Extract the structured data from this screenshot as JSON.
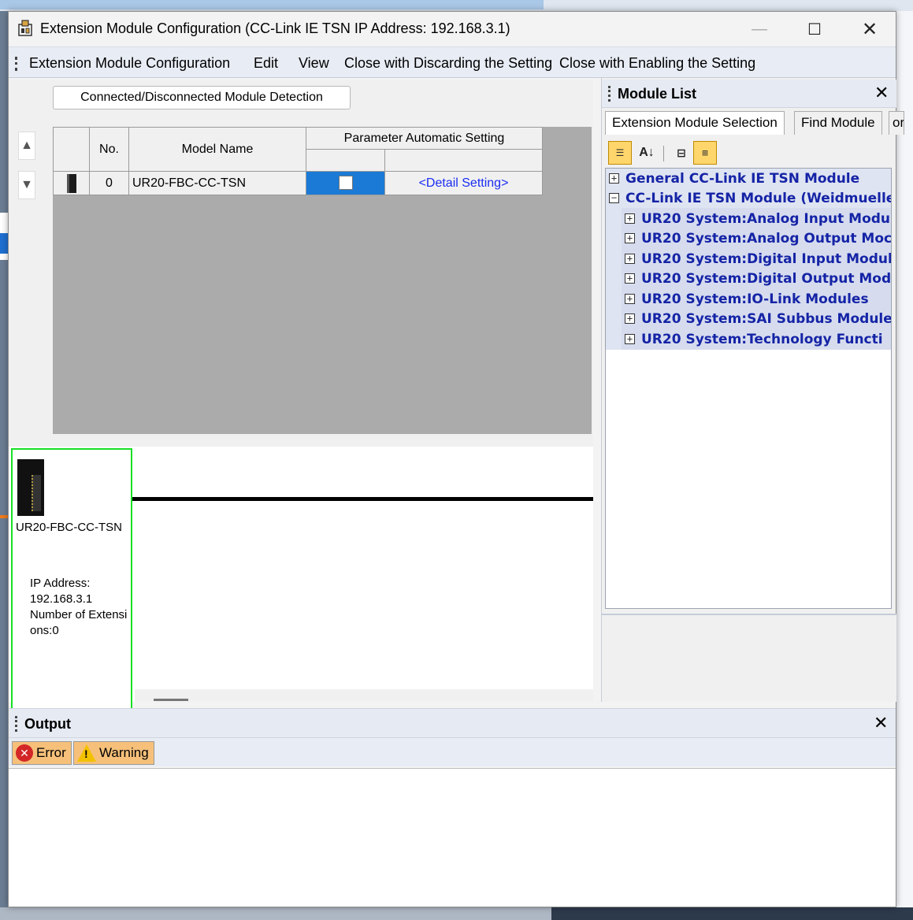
{
  "window": {
    "title": "Extension Module Configuration (CC-Link IE TSN IP Address: 192.168.3.1)",
    "min_glyph": "—",
    "max_glyph": "☐",
    "close_glyph": "✕"
  },
  "menu": {
    "items": [
      "Extension Module Configuration",
      "Edit",
      "View",
      "Close with Discarding the Setting",
      "Close with Enabling the Setting"
    ]
  },
  "main": {
    "detect_button": "Connected/Disconnected Module Detection",
    "up_arrow": "▲",
    "down_arrow": "▼",
    "grid": {
      "col_no": "No.",
      "col_model": "Model Name",
      "col_param": "Parameter Automatic Setting",
      "rows": [
        {
          "no": "0",
          "model": "UR20-FBC-CC-TSN",
          "detail": "<Detail Setting>"
        }
      ]
    },
    "diagram": {
      "module_name": "UR20-FBC-CC-TSN",
      "info": "IP Address:\n192.168.3.1\nNumber of Extensions:0"
    }
  },
  "module_list": {
    "title": "Module List",
    "close_glyph": "✕",
    "tabs": [
      "Extension Module Selection",
      "Find Module",
      "ori"
    ],
    "toolbar": [
      "category-sort",
      "alpha-sort",
      "collapse-all",
      "expand-all"
    ],
    "tree": [
      {
        "label": "General CC-Link IE TSN Module",
        "sign": "+",
        "level": 0
      },
      {
        "label": "CC-Link IE TSN Module (Weidmueller",
        "sign": "−",
        "level": 0
      },
      {
        "label": "UR20 System:Analog Input Modu",
        "sign": "+",
        "level": 1
      },
      {
        "label": "UR20 System:Analog Output Moc",
        "sign": "+",
        "level": 1
      },
      {
        "label": "UR20 System:Digital Input Modul",
        "sign": "+",
        "level": 1
      },
      {
        "label": "UR20 System:Digital Output Mod",
        "sign": "+",
        "level": 1
      },
      {
        "label": "UR20 System:IO-Link Modules",
        "sign": "+",
        "level": 1
      },
      {
        "label": "UR20 System:SAI Subbus Module",
        "sign": "+",
        "level": 1
      },
      {
        "label": "UR20 System:Technology Functi",
        "sign": "+",
        "level": 1
      }
    ]
  },
  "output": {
    "title": "Output",
    "close_glyph": "✕",
    "error_tab": "Error",
    "warning_tab": "Warning",
    "error_glyph": "✕",
    "warning_glyph": "!"
  }
}
